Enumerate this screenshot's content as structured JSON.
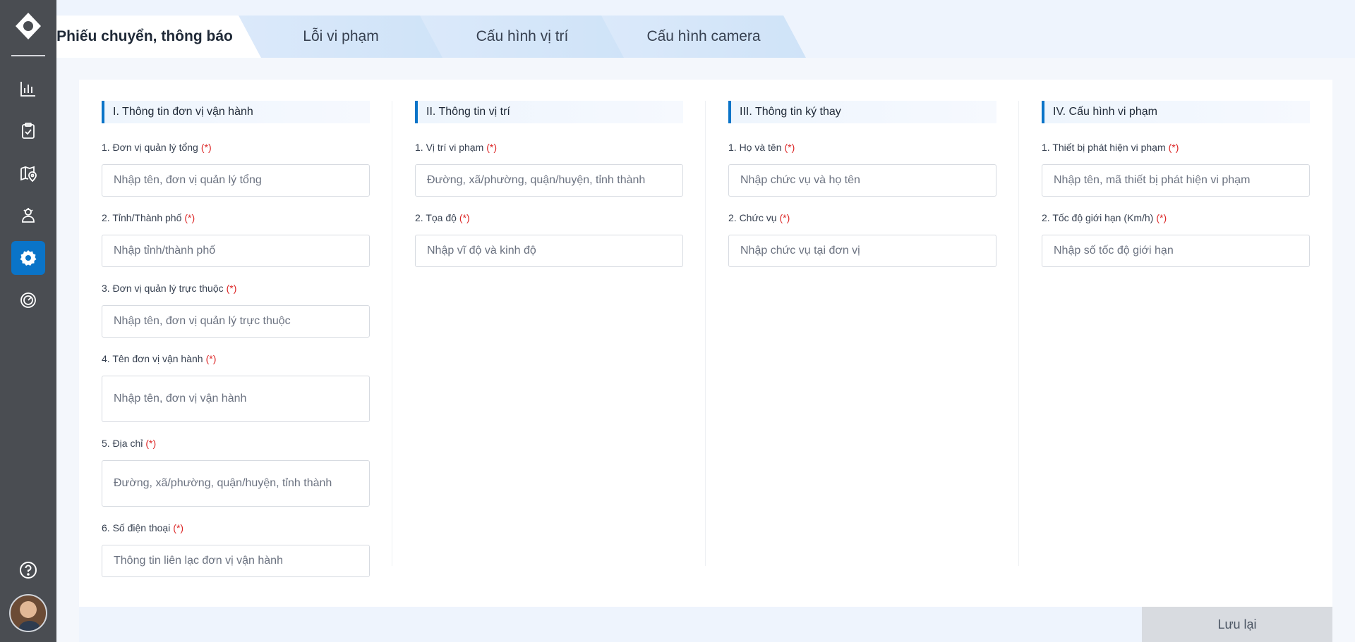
{
  "tabs": [
    {
      "label": "Phiếu chuyển, thông báo"
    },
    {
      "label": "Lỗi vi phạm"
    },
    {
      "label": "Cấu hình vị trí"
    },
    {
      "label": "Cấu hình camera"
    }
  ],
  "required_mark": "(*)",
  "sections": {
    "operator": {
      "title": "I. Thông tin đơn vị vận hành",
      "fields": [
        {
          "label": "1. Đơn vị quản lý tổng",
          "placeholder": "Nhập tên, đơn vị quản lý tổng"
        },
        {
          "label": "2. Tỉnh/Thành phố",
          "placeholder": "Nhập tỉnh/thành phố"
        },
        {
          "label": "3. Đơn vị quản lý trực thuộc",
          "placeholder": "Nhập tên, đơn vị quản lý trực thuộc"
        },
        {
          "label": "4. Tên đơn vị vận hành",
          "placeholder": "Nhập tên, đơn vị vận hành"
        },
        {
          "label": "5. Địa chỉ",
          "placeholder": "Đường, xã/phường, quận/huyện, tỉnh thành"
        },
        {
          "label": "6. Số điện thoại",
          "placeholder": "Thông tin liên lạc đơn vị vận hành"
        }
      ]
    },
    "location": {
      "title": "II. Thông tin vị trí",
      "fields": [
        {
          "label": "1. Vị trí vi phạm",
          "placeholder": "Đường, xã/phường, quận/huyện, tỉnh thành"
        },
        {
          "label": "2. Tọa độ",
          "placeholder": "Nhập vĩ độ và kinh độ"
        }
      ]
    },
    "signer": {
      "title": "III. Thông tin ký thay",
      "fields": [
        {
          "label": "1. Họ và tên",
          "placeholder": "Nhập chức vụ và họ tên"
        },
        {
          "label": "2. Chức vụ",
          "placeholder": "Nhập chức vụ tại đơn vị"
        }
      ]
    },
    "violation": {
      "title": "IV. Cấu hình vi phạm",
      "fields": [
        {
          "label": "1. Thiết bị phát hiện vi phạm",
          "placeholder": "Nhập tên, mã thiết bị phát hiện vi phạm"
        },
        {
          "label": "2. Tốc độ giới hạn (Km/h)",
          "placeholder": "Nhập số tốc độ giới hạn"
        }
      ]
    }
  },
  "footer": {
    "save_label": "Lưu lại"
  },
  "colors": {
    "accent": "#0a74c8",
    "sidebar": "#4a4d52",
    "required": "#dc2626"
  },
  "sidebar": {
    "items": [
      {
        "icon": "bar-chart-icon"
      },
      {
        "icon": "clipboard-check-icon"
      },
      {
        "icon": "map-pin-icon"
      },
      {
        "icon": "users-gear-icon"
      },
      {
        "icon": "settings-icon",
        "active": true
      },
      {
        "icon": "speedometer-icon"
      }
    ],
    "bottom": [
      {
        "icon": "help-icon"
      },
      {
        "icon": "user-avatar"
      }
    ]
  }
}
